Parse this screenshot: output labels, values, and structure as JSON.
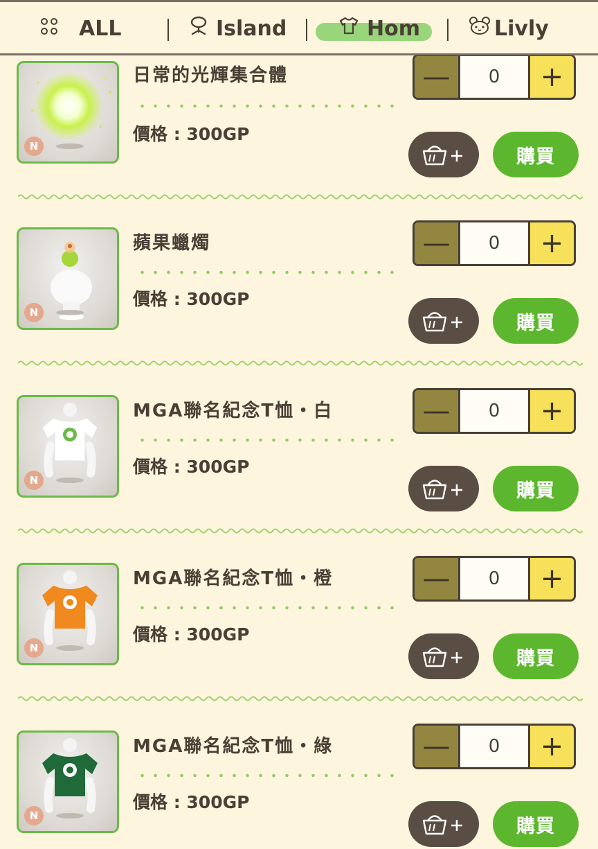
{
  "tabs": [
    {
      "label": "ALL",
      "icon": "grid-dots-icon",
      "active": false
    },
    {
      "label": "Island",
      "icon": "island-tree-icon",
      "active": false
    },
    {
      "label": "Hom",
      "icon": "shirt-icon",
      "active": true
    },
    {
      "label": "Livly",
      "icon": "livly-face-icon",
      "active": false
    }
  ],
  "items": [
    {
      "name": "日常的光輝集合體",
      "price": "價格 : 300GP",
      "quantity": "0",
      "rarity": "N",
      "buy_label": "購買",
      "thumb": "glow"
    },
    {
      "name": "蘋果蠟燭",
      "price": "價格 : 300GP",
      "quantity": "0",
      "rarity": "N",
      "buy_label": "購買",
      "thumb": "candle"
    },
    {
      "name": "MGA聯名紀念T恤・白",
      "price": "價格 : 300GP",
      "quantity": "0",
      "rarity": "N",
      "buy_label": "購買",
      "thumb": "shirt-white"
    },
    {
      "name": "MGA聯名紀念T恤・橙",
      "price": "價格 : 300GP",
      "quantity": "0",
      "rarity": "N",
      "buy_label": "購買",
      "thumb": "shirt-orange"
    },
    {
      "name": "MGA聯名紀念T恤・綠",
      "price": "價格 : 300GP",
      "quantity": "0",
      "rarity": "N",
      "buy_label": "購買",
      "thumb": "shirt-green"
    }
  ],
  "colors": {
    "background": "#fdf5dd",
    "accent_green": "#5db72e",
    "minus_button": "#938640",
    "plus_button": "#f7e15a",
    "cart_button": "#5a4d44"
  }
}
